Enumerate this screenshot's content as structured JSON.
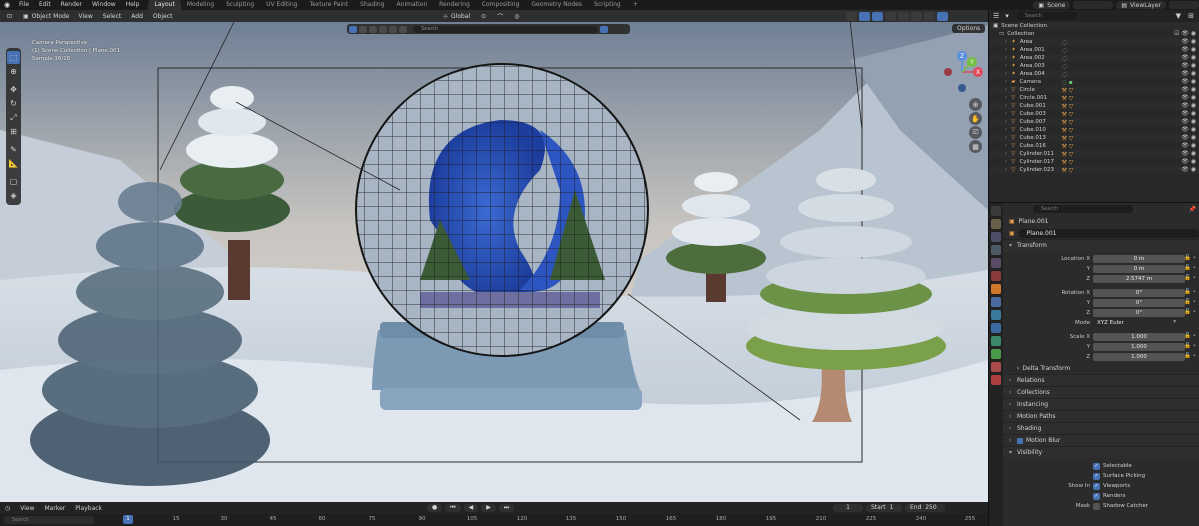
{
  "topbar": {
    "menu": [
      "File",
      "Edit",
      "Render",
      "Window",
      "Help"
    ],
    "tabs": [
      "Layout",
      "Modeling",
      "Sculpting",
      "UV Editing",
      "Texture Paint",
      "Shading",
      "Animation",
      "Rendering",
      "Compositing",
      "Geometry Nodes",
      "Scripting"
    ],
    "active_tab": "Layout",
    "add_tab": "+",
    "scene": "Scene",
    "view_layer": "ViewLayer"
  },
  "viewport": {
    "mode": "Object Mode",
    "menu": [
      "View",
      "Select",
      "Add",
      "Object"
    ],
    "orientation": "Global",
    "search_placeholder": "Search",
    "options_label": "Options",
    "overlay_lines": [
      "Camera Perspective",
      "(1) Scene Collection | Plane.001",
      "Sample 16/16"
    ],
    "gizmo": {
      "x": "X",
      "y": "Y",
      "z": "Z"
    }
  },
  "timeline": {
    "menu": [
      "View",
      "Marker",
      "Playback"
    ],
    "current_frame": "1",
    "start_label": "Start",
    "start": "1",
    "end_label": "End",
    "end": "250",
    "search_placeholder": "Search",
    "ticks": [
      "1",
      "15",
      "30",
      "45",
      "60",
      "75",
      "90",
      "105",
      "120",
      "135",
      "150",
      "165",
      "180",
      "195",
      "210",
      "225",
      "240",
      "255"
    ]
  },
  "outliner": {
    "search_placeholder": "Search",
    "root": "Scene Collection",
    "collection": "Collection",
    "items": [
      {
        "name": "Area",
        "type": "light"
      },
      {
        "name": "Area.001",
        "type": "light"
      },
      {
        "name": "Area.002",
        "type": "light"
      },
      {
        "name": "Area.003",
        "type": "light"
      },
      {
        "name": "Area.004",
        "type": "light"
      },
      {
        "name": "Camera",
        "type": "camera"
      },
      {
        "name": "Circle",
        "type": "mesh"
      },
      {
        "name": "Circle.001",
        "type": "mesh"
      },
      {
        "name": "Cube.001",
        "type": "mesh"
      },
      {
        "name": "Cube.003",
        "type": "mesh"
      },
      {
        "name": "Cube.007",
        "type": "mesh"
      },
      {
        "name": "Cube.010",
        "type": "mesh"
      },
      {
        "name": "Cube.013",
        "type": "mesh"
      },
      {
        "name": "Cube.016",
        "type": "mesh"
      },
      {
        "name": "Cylinder.011",
        "type": "mesh"
      },
      {
        "name": "Cylinder.017",
        "type": "mesh"
      },
      {
        "name": "Cylinder.023",
        "type": "mesh"
      }
    ]
  },
  "properties": {
    "search_placeholder": "Search",
    "object_name": "Plane.001",
    "sections": {
      "transform": "Transform",
      "delta_transform": "Delta Transform",
      "relations": "Relations",
      "collections": "Collections",
      "instancing": "Instancing",
      "motion_paths": "Motion Paths",
      "shading": "Shading",
      "motion_blur": "Motion Blur",
      "visibility": "Visibility"
    },
    "location_label": "Location X",
    "location": [
      "0 m",
      "0 m",
      "2.5747 m"
    ],
    "rotation_label": "Rotation X",
    "rotation": [
      "0°",
      "0°",
      "0°"
    ],
    "mode_label": "Mode",
    "mode": "XYZ Euler",
    "scale_label": "Scale X",
    "scale": [
      "1.000",
      "1.000",
      "1.000"
    ],
    "axis_y": "Y",
    "axis_z": "Z",
    "visibility": {
      "selectable": "Selectable",
      "surface_picking": "Surface Picking",
      "show_in_label": "Show In",
      "viewports": "Viewports",
      "renders": "Renders",
      "mask_label": "Mask",
      "shadow_catcher": "Shadow Catcher"
    }
  },
  "colors": {
    "accent": "#4772b3",
    "panel": "#2b2b2b",
    "header": "#232323"
  }
}
